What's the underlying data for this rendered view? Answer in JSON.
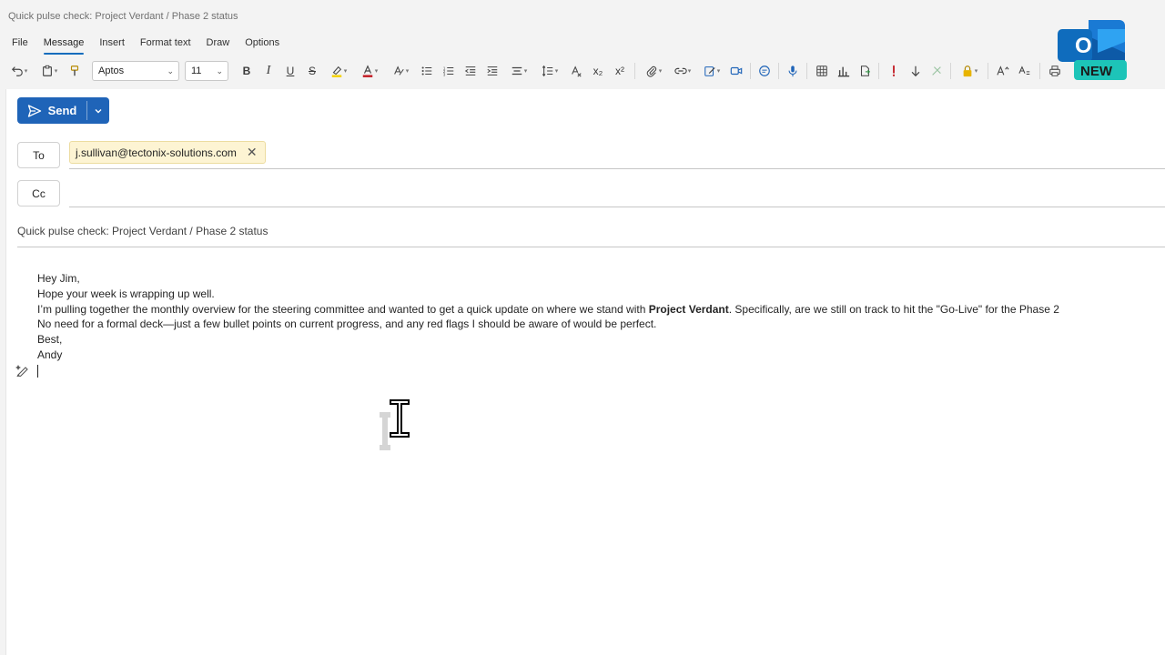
{
  "window": {
    "title": "Quick pulse check: Project Verdant / Phase 2 status"
  },
  "menu": {
    "tabs": [
      {
        "label": "File"
      },
      {
        "label": "Message"
      },
      {
        "label": "Insert"
      },
      {
        "label": "Format text"
      },
      {
        "label": "Draw"
      },
      {
        "label": "Options"
      }
    ],
    "active": "Message"
  },
  "toolbar": {
    "font_name": "Aptos",
    "font_size": "11",
    "bold": "B",
    "italic": "I",
    "underline": "U",
    "strike": "S",
    "subscript": "x₂",
    "superscript": "x²",
    "icons": [
      "undo-icon",
      "paste-icon",
      "format-painter-icon",
      "bold-icon",
      "italic-icon",
      "underline-icon",
      "strikethrough-icon",
      "highlight-icon",
      "font-color-icon",
      "styles-icon",
      "bullets-icon",
      "numbering-icon",
      "decrease-indent-icon",
      "increase-indent-icon",
      "align-icon",
      "spacing-icon",
      "clear-format-icon",
      "subscript-icon",
      "superscript-icon",
      "attach-icon",
      "link-icon",
      "signature-icon",
      "meeting-icon",
      "comment-icon",
      "dictate-icon",
      "table-icon",
      "chart-icon",
      "insert-icon",
      "importance-high-icon",
      "importance-low-icon",
      "sensitivity-icon",
      "lock-icon",
      "font-size-icon",
      "text-effects-icon",
      "print-icon"
    ],
    "highlight_color": "#f5d40f",
    "font_color": "#c4262e"
  },
  "compose": {
    "send_label": "Send",
    "to_label": "To",
    "cc_label": "Cc",
    "to_recipient": "j.sullivan@tectonix-solutions.com",
    "subject": "Quick pulse check: Project Verdant / Phase 2 status",
    "body": {
      "greeting": "Hey Jim,",
      "line1": "Hope your week is wrapping up well.",
      "line2_pre": "I’m pulling together the monthly overview for the steering committee and wanted to get a quick update on where we stand with ",
      "line2_bold": "Project Verdant",
      "line2_post": ". Specifically, are we still on track to hit the \"Go-Live\" for the Phase 2",
      "line3": "No need for a formal deck—just a few bullet points on current progress, and any red flags I should be aware of would be perfect.",
      "signoff": "Best,",
      "name": "Andy"
    }
  },
  "branding": {
    "badge_text": "NEW",
    "logo_letter": "O",
    "accent": "#0f6cbd",
    "badge_color": "#1dc4b8"
  }
}
